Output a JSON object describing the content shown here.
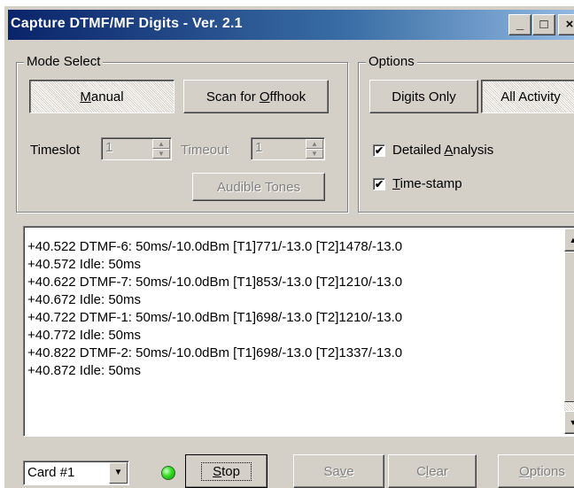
{
  "window": {
    "title": "Capture DTMF/MF Digits - Ver. 2.1",
    "controls": {
      "minimize": "_",
      "maximize": "□",
      "close": "×"
    }
  },
  "mode_select": {
    "legend": "Mode Select",
    "manual": {
      "pre": "",
      "accel": "M",
      "post": "anual"
    },
    "scan": {
      "pre": "Scan for ",
      "accel": "O",
      "post": "ffhook"
    },
    "timeslot": {
      "label": "Timeslot",
      "value": "1"
    },
    "timeout": {
      "label": "Timeout",
      "value": "1"
    },
    "audible_tones": "Audible Tones"
  },
  "options": {
    "legend": "Options",
    "digits_only": "Digits Only",
    "all_activity": "All Activity",
    "detailed": {
      "pre": "Detailed ",
      "accel": "A",
      "post": "nalysis",
      "checked": true
    },
    "timestamp": {
      "pre": "",
      "accel": "T",
      "post": "ime-stamp",
      "checked": true
    },
    "check_glyph": "✔"
  },
  "log": {
    "lines": [
      "+40.522 DTMF-6: 50ms/-10.0dBm  [T1]771/-13.0  [T2]1478/-13.0",
      "+40.572 Idle: 50ms",
      "+40.622 DTMF-7: 50ms/-10.0dBm  [T1]853/-13.0  [T2]1210/-13.0",
      "+40.672 Idle: 50ms",
      "+40.722 DTMF-1: 50ms/-10.0dBm  [T1]698/-13.0  [T2]1210/-13.0",
      "+40.772 Idle: 50ms",
      "+40.822 DTMF-2: 50ms/-10.0dBm  [T1]698/-13.0  [T2]1337/-13.0",
      "+40.872 Idle: 50ms"
    ]
  },
  "bottom": {
    "card": {
      "value": "Card #1"
    },
    "stop": {
      "pre": "",
      "accel": "S",
      "post": "top"
    },
    "save": {
      "pre": "Sa",
      "accel": "v",
      "post": "e"
    },
    "clear": {
      "pre": "C",
      "accel": "l",
      "post": "ear"
    },
    "options": {
      "pre": "",
      "accel": "O",
      "post": "ptions"
    }
  },
  "colors": {
    "face": "#d4d0c8",
    "title_start": "#0a246a",
    "title_end": "#a6caf0",
    "led": "#33dd22",
    "disabled_text": "#808080"
  },
  "icons": {
    "spin_up": "▲",
    "spin_down": "▼",
    "scroll_up": "▲",
    "scroll_down": "▼",
    "dropdown": "▼"
  }
}
